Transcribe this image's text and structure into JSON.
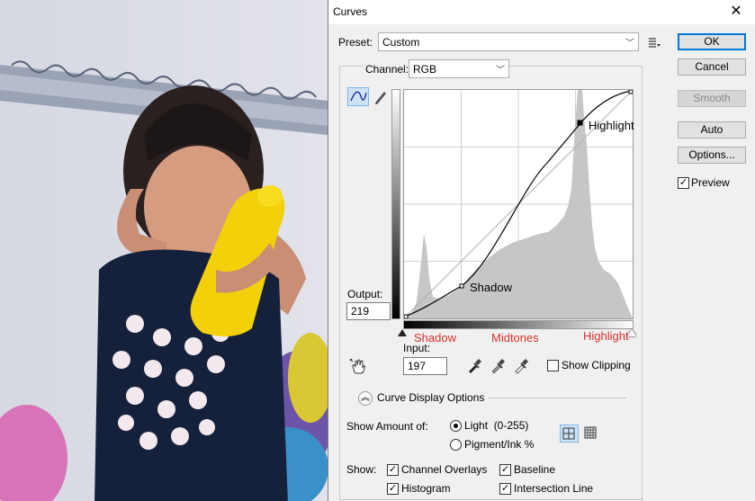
{
  "window": {
    "title": "Curves",
    "close_glyph": "✕"
  },
  "preset": {
    "label": "Preset:",
    "value": "Custom"
  },
  "channel": {
    "label": "Channel:",
    "value": "RGB"
  },
  "buttons": {
    "ok": "OK",
    "cancel": "Cancel",
    "smooth": "Smooth",
    "auto": "Auto",
    "options": "Options..."
  },
  "preview": {
    "label": "Preview",
    "checked": true
  },
  "output": {
    "label": "Output:",
    "value": "219"
  },
  "input": {
    "label": "Input:",
    "value": "197"
  },
  "graph_labels": {
    "shadow_point": "Shadow",
    "highlight_point": "Highlight"
  },
  "gradient_labels": {
    "shadow": "Shadow",
    "midtones": "Midtones",
    "highlight": "Highlight"
  },
  "show_clipping": {
    "label": "Show Clipping",
    "checked": false
  },
  "curve_display": {
    "label": "Curve Display Options"
  },
  "show_amount": {
    "label": "Show Amount of:",
    "options": [
      "Light  (0-255)",
      "Pigment/Ink %"
    ],
    "selected": "Light  (0-255)"
  },
  "show": {
    "label": "Show:",
    "options": [
      {
        "label": "Channel Overlays",
        "checked": true
      },
      {
        "label": "Baseline",
        "checked": true
      },
      {
        "label": "Histogram",
        "checked": true
      },
      {
        "label": "Intersection Line",
        "checked": true
      }
    ]
  },
  "colors": {
    "accent": "#0078d7",
    "label_red": "#d9312b",
    "dialog_bg": "#f0f0f0"
  }
}
